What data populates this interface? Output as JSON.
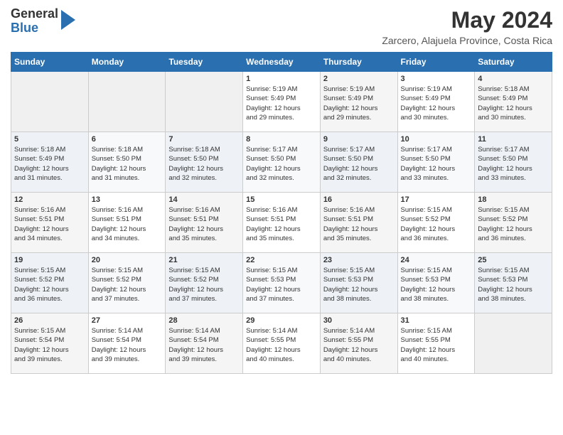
{
  "header": {
    "logo_general": "General",
    "logo_blue": "Blue",
    "month_title": "May 2024",
    "location": "Zarcero, Alajuela Province, Costa Rica"
  },
  "days_of_week": [
    "Sunday",
    "Monday",
    "Tuesday",
    "Wednesday",
    "Thursday",
    "Friday",
    "Saturday"
  ],
  "weeks": [
    [
      {
        "num": "",
        "info": ""
      },
      {
        "num": "",
        "info": ""
      },
      {
        "num": "",
        "info": ""
      },
      {
        "num": "1",
        "info": "Sunrise: 5:19 AM\nSunset: 5:49 PM\nDaylight: 12 hours\nand 29 minutes."
      },
      {
        "num": "2",
        "info": "Sunrise: 5:19 AM\nSunset: 5:49 PM\nDaylight: 12 hours\nand 29 minutes."
      },
      {
        "num": "3",
        "info": "Sunrise: 5:19 AM\nSunset: 5:49 PM\nDaylight: 12 hours\nand 30 minutes."
      },
      {
        "num": "4",
        "info": "Sunrise: 5:18 AM\nSunset: 5:49 PM\nDaylight: 12 hours\nand 30 minutes."
      }
    ],
    [
      {
        "num": "5",
        "info": "Sunrise: 5:18 AM\nSunset: 5:49 PM\nDaylight: 12 hours\nand 31 minutes."
      },
      {
        "num": "6",
        "info": "Sunrise: 5:18 AM\nSunset: 5:50 PM\nDaylight: 12 hours\nand 31 minutes."
      },
      {
        "num": "7",
        "info": "Sunrise: 5:18 AM\nSunset: 5:50 PM\nDaylight: 12 hours\nand 32 minutes."
      },
      {
        "num": "8",
        "info": "Sunrise: 5:17 AM\nSunset: 5:50 PM\nDaylight: 12 hours\nand 32 minutes."
      },
      {
        "num": "9",
        "info": "Sunrise: 5:17 AM\nSunset: 5:50 PM\nDaylight: 12 hours\nand 32 minutes."
      },
      {
        "num": "10",
        "info": "Sunrise: 5:17 AM\nSunset: 5:50 PM\nDaylight: 12 hours\nand 33 minutes."
      },
      {
        "num": "11",
        "info": "Sunrise: 5:17 AM\nSunset: 5:50 PM\nDaylight: 12 hours\nand 33 minutes."
      }
    ],
    [
      {
        "num": "12",
        "info": "Sunrise: 5:16 AM\nSunset: 5:51 PM\nDaylight: 12 hours\nand 34 minutes."
      },
      {
        "num": "13",
        "info": "Sunrise: 5:16 AM\nSunset: 5:51 PM\nDaylight: 12 hours\nand 34 minutes."
      },
      {
        "num": "14",
        "info": "Sunrise: 5:16 AM\nSunset: 5:51 PM\nDaylight: 12 hours\nand 35 minutes."
      },
      {
        "num": "15",
        "info": "Sunrise: 5:16 AM\nSunset: 5:51 PM\nDaylight: 12 hours\nand 35 minutes."
      },
      {
        "num": "16",
        "info": "Sunrise: 5:16 AM\nSunset: 5:51 PM\nDaylight: 12 hours\nand 35 minutes."
      },
      {
        "num": "17",
        "info": "Sunrise: 5:15 AM\nSunset: 5:52 PM\nDaylight: 12 hours\nand 36 minutes."
      },
      {
        "num": "18",
        "info": "Sunrise: 5:15 AM\nSunset: 5:52 PM\nDaylight: 12 hours\nand 36 minutes."
      }
    ],
    [
      {
        "num": "19",
        "info": "Sunrise: 5:15 AM\nSunset: 5:52 PM\nDaylight: 12 hours\nand 36 minutes."
      },
      {
        "num": "20",
        "info": "Sunrise: 5:15 AM\nSunset: 5:52 PM\nDaylight: 12 hours\nand 37 minutes."
      },
      {
        "num": "21",
        "info": "Sunrise: 5:15 AM\nSunset: 5:52 PM\nDaylight: 12 hours\nand 37 minutes."
      },
      {
        "num": "22",
        "info": "Sunrise: 5:15 AM\nSunset: 5:53 PM\nDaylight: 12 hours\nand 37 minutes."
      },
      {
        "num": "23",
        "info": "Sunrise: 5:15 AM\nSunset: 5:53 PM\nDaylight: 12 hours\nand 38 minutes."
      },
      {
        "num": "24",
        "info": "Sunrise: 5:15 AM\nSunset: 5:53 PM\nDaylight: 12 hours\nand 38 minutes."
      },
      {
        "num": "25",
        "info": "Sunrise: 5:15 AM\nSunset: 5:53 PM\nDaylight: 12 hours\nand 38 minutes."
      }
    ],
    [
      {
        "num": "26",
        "info": "Sunrise: 5:15 AM\nSunset: 5:54 PM\nDaylight: 12 hours\nand 39 minutes."
      },
      {
        "num": "27",
        "info": "Sunrise: 5:14 AM\nSunset: 5:54 PM\nDaylight: 12 hours\nand 39 minutes."
      },
      {
        "num": "28",
        "info": "Sunrise: 5:14 AM\nSunset: 5:54 PM\nDaylight: 12 hours\nand 39 minutes."
      },
      {
        "num": "29",
        "info": "Sunrise: 5:14 AM\nSunset: 5:55 PM\nDaylight: 12 hours\nand 40 minutes."
      },
      {
        "num": "30",
        "info": "Sunrise: 5:14 AM\nSunset: 5:55 PM\nDaylight: 12 hours\nand 40 minutes."
      },
      {
        "num": "31",
        "info": "Sunrise: 5:15 AM\nSunset: 5:55 PM\nDaylight: 12 hours\nand 40 minutes."
      },
      {
        "num": "",
        "info": ""
      }
    ]
  ]
}
